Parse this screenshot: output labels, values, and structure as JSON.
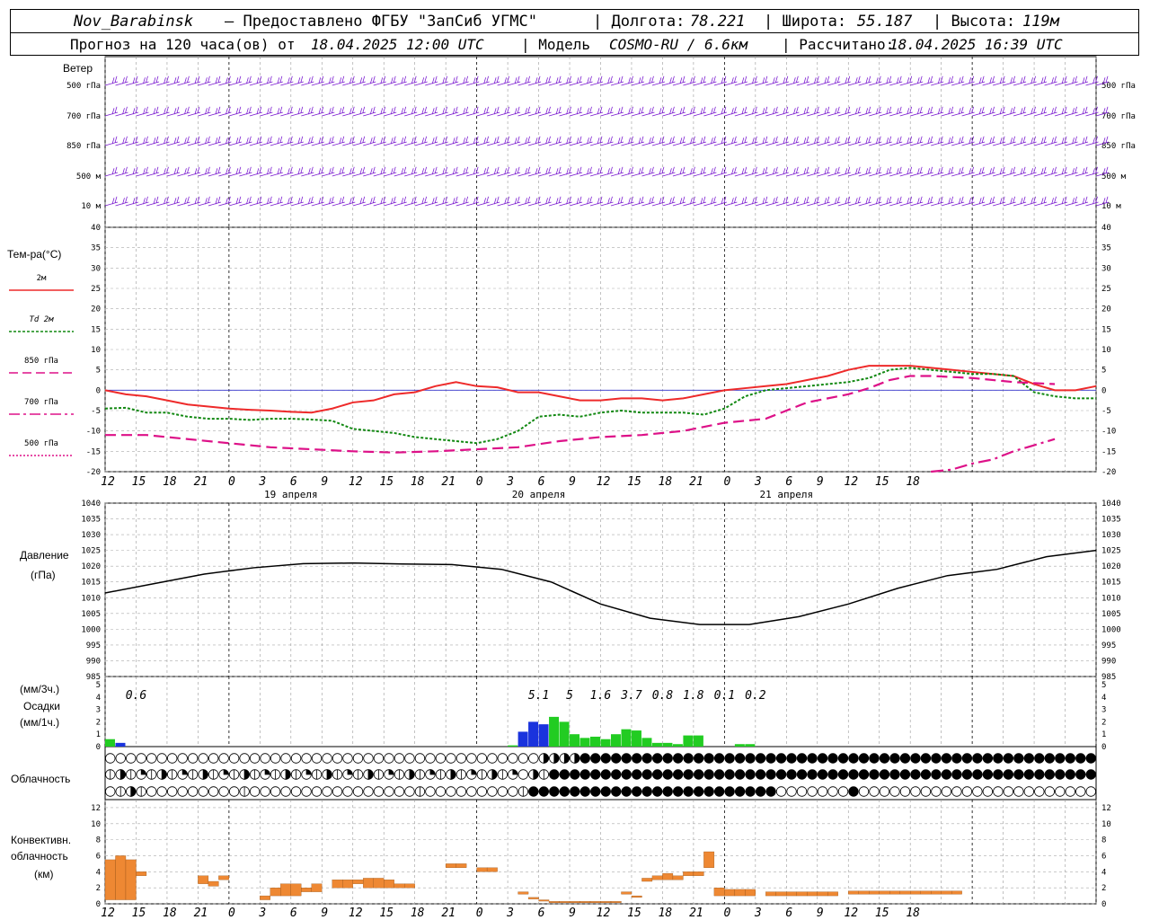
{
  "header": {
    "station": "Nov_Barabinsk",
    "provider": "– Предоставлено ФГБУ \"ЗапСиб УГМС\"",
    "lon_label": "| Долгота:",
    "lon_value": "78.221",
    "lat_label": "| Широта:",
    "lat_value": "55.187",
    "alt_label": "| Высота:",
    "alt_value": "119м",
    "forecast_label": "Прогноз на 120 часа(ов) от",
    "forecast_start": "18.04.2025 12:00 UTC",
    "model_label": "| Модель",
    "model_value": "COSMO-RU / 6.6км",
    "calc_label": "| Рассчитано:",
    "calc_value": "18.04.2025 16:39 UTC"
  },
  "x_axis": {
    "ticks": [
      "12",
      "15",
      "18",
      "21",
      "0",
      "3",
      "6",
      "9",
      "12",
      "15",
      "18",
      "21",
      "0",
      "3",
      "6",
      "9",
      "12",
      "15",
      "18",
      "21",
      "0",
      "3",
      "6",
      "9",
      "12",
      "15",
      "18"
    ],
    "dates": [
      "19 апреля",
      "20 апреля",
      "21 апреля"
    ]
  },
  "colors": {
    "t2m": "#ee2a2a",
    "td2m": "#118811",
    "t850": "#dd1188",
    "t700": "#dd1188",
    "t500": "#dd1188",
    "wind": "#7a1ad0",
    "pressure": "#000000",
    "precip_conv": "#1a33dd",
    "precip_large": "#22cc22",
    "conv_cloud": "#ee8833",
    "zero_line": "#3333cc"
  },
  "wind_panel": {
    "title": "Ветер",
    "levels": [
      "500 гПа",
      "700 гПа",
      "850 гПа",
      "500 м",
      "10 м"
    ]
  },
  "temp_panel": {
    "title": "Тем-ра(°С)",
    "legend": [
      {
        "label": "2м",
        "style": "solid"
      },
      {
        "label": "Td 2м",
        "style": "dotted"
      },
      {
        "label": "850 гПа",
        "style": "dash"
      },
      {
        "label": "700 гПа",
        "style": "dashdot"
      },
      {
        "label": "500 гПа",
        "style": "dotted"
      }
    ],
    "yticks": [
      "40",
      "35",
      "30",
      "25",
      "20",
      "15",
      "10",
      "5",
      "0",
      "-5",
      "-10",
      "-15",
      "-20"
    ]
  },
  "pressure_panel": {
    "title_1": "Давление",
    "title_2": "(гПа)",
    "yticks": [
      "1040",
      "1035",
      "1030",
      "1025",
      "1020",
      "1015",
      "1010",
      "1005",
      "1000",
      "995",
      "990",
      "985"
    ]
  },
  "precip_panel": {
    "title_1": "(мм/3ч.)",
    "title_2": "Осадки",
    "title_3": "(мм/1ч.)",
    "yticks": [
      "5",
      "4",
      "3",
      "2",
      "1",
      "0"
    ],
    "totals": [
      {
        "hour": 3,
        "text": "0.6"
      },
      {
        "hour": 42,
        "text": "5.1"
      },
      {
        "hour": 45,
        "text": "5"
      },
      {
        "hour": 48,
        "text": "1.6"
      },
      {
        "hour": 51,
        "text": "3.7"
      },
      {
        "hour": 54,
        "text": "0.8"
      },
      {
        "hour": 57,
        "text": "1.8"
      },
      {
        "hour": 60,
        "text": "0.1"
      },
      {
        "hour": 63,
        "text": "0.2"
      }
    ]
  },
  "cloud_panel": {
    "title": "Облачность"
  },
  "conv_panel": {
    "title_1": "Конвективн.",
    "title_2": "облачность",
    "title_3": "(км)",
    "yticks": [
      "12",
      "10",
      "8",
      "6",
      "4",
      "2",
      "0"
    ]
  },
  "chart_data": {
    "type": "line",
    "x_unit": "hours since 18.04.2025 12:00 UTC",
    "temperature": {
      "ylim": [
        -20,
        40
      ],
      "series": [
        {
          "name": "2м",
          "x": [
            0,
            2,
            4,
            6,
            8,
            10,
            12,
            14,
            16,
            18,
            20,
            22,
            24,
            26,
            28,
            30,
            32,
            34,
            36,
            38,
            40,
            42,
            44,
            46,
            48,
            50,
            52,
            54,
            56,
            58,
            60,
            62,
            64,
            66,
            68,
            70,
            72,
            74,
            76,
            78,
            80,
            82,
            84,
            86,
            88,
            90,
            92,
            94,
            96
          ],
          "y": [
            0,
            -1,
            -1.5,
            -2.5,
            -3.5,
            -4,
            -4.5,
            -4.8,
            -5,
            -5.3,
            -5.5,
            -4.5,
            -3,
            -2.5,
            -1,
            -0.5,
            1,
            2,
            1,
            0.7,
            -0.5,
            -0.5,
            -1.5,
            -2.5,
            -2.5,
            -2,
            -2,
            -2.5,
            -2,
            -1,
            0,
            0.5,
            1,
            1.5,
            2.5,
            3.5,
            5,
            6,
            6,
            6,
            5.5,
            5,
            4.5,
            4,
            3.5,
            1.5,
            0,
            0,
            1
          ]
        },
        {
          "name": "Td 2м",
          "x": [
            0,
            2,
            4,
            6,
            8,
            10,
            12,
            14,
            16,
            18,
            20,
            22,
            24,
            26,
            28,
            30,
            32,
            34,
            36,
            38,
            40,
            42,
            44,
            46,
            48,
            50,
            52,
            54,
            56,
            58,
            60,
            62,
            64,
            66,
            68,
            70,
            72,
            74,
            76,
            78,
            80,
            82,
            84,
            86,
            88,
            90,
            92,
            94,
            96
          ],
          "y": [
            -4.5,
            -4.3,
            -5.5,
            -5.5,
            -6.5,
            -7,
            -7,
            -7.3,
            -7,
            -7,
            -7.2,
            -7.5,
            -9.5,
            -10,
            -10.5,
            -11.5,
            -12,
            -12.5,
            -13,
            -12,
            -10,
            -6.5,
            -6,
            -6.5,
            -5.5,
            -5,
            -5.5,
            -5.5,
            -5.5,
            -6,
            -4.5,
            -1.5,
            0,
            0.5,
            1,
            1.5,
            2,
            3,
            5,
            5.5,
            5,
            4.5,
            4,
            4,
            3.5,
            -0.5,
            -1.5,
            -2,
            -2
          ]
        },
        {
          "name": "850 гПа",
          "x": [
            0,
            4,
            8,
            12,
            16,
            20,
            24,
            28,
            32,
            36,
            40,
            44,
            48,
            52,
            56,
            60,
            64,
            68,
            72,
            74,
            76,
            78,
            80,
            84,
            88,
            92
          ],
          "y": [
            -11,
            -11,
            -12,
            -13,
            -14,
            -14.5,
            -15,
            -15.3,
            -15,
            -14.5,
            -14,
            -12.5,
            -11.5,
            -11,
            -10,
            -8,
            -7,
            -3,
            -1,
            0.5,
            2.5,
            3.5,
            3.5,
            3,
            2,
            1.5
          ]
        },
        {
          "name": "700 гПа",
          "x": [
            80,
            82,
            84,
            86,
            88,
            90,
            92
          ],
          "y": [
            -20,
            -19.5,
            -18,
            -17,
            -15,
            -13.5,
            -12
          ]
        },
        {
          "name": "500 гПа",
          "x": [
            112,
            116,
            120,
            124,
            128
          ],
          "y": [
            -20,
            -20,
            -20,
            -20,
            -20
          ]
        }
      ]
    },
    "pressure": {
      "ylim": [
        985,
        1040
      ],
      "x": [
        0,
        6,
        12,
        18,
        24,
        30,
        36,
        42,
        48,
        54,
        60,
        66,
        72,
        78,
        84,
        90,
        96,
        102,
        108,
        114,
        120
      ],
      "y": [
        1011.5,
        1014.5,
        1017.5,
        1019.5,
        1020.8,
        1021,
        1020.7,
        1020.5,
        1019,
        1015,
        1008,
        1003.5,
        1001.5,
        1001.5,
        1004,
        1008,
        1013,
        1017,
        1019,
        1023,
        1025
      ]
    },
    "precip": {
      "ylim": [
        0,
        5
      ],
      "bars": [
        {
          "x": 0,
          "v": 0.6,
          "type": "large"
        },
        {
          "x": 1,
          "v": 0.3,
          "type": "conv"
        },
        {
          "x": 39,
          "v": 0.1,
          "type": "large"
        },
        {
          "x": 40,
          "v": 1.2,
          "type": "conv"
        },
        {
          "x": 41,
          "v": 2.0,
          "type": "conv"
        },
        {
          "x": 42,
          "v": 1.8,
          "type": "conv"
        },
        {
          "x": 43,
          "v": 2.4,
          "type": "large"
        },
        {
          "x": 44,
          "v": 2.0,
          "type": "large"
        },
        {
          "x": 45,
          "v": 1.0,
          "type": "large"
        },
        {
          "x": 46,
          "v": 0.7,
          "type": "large"
        },
        {
          "x": 47,
          "v": 0.8,
          "type": "large"
        },
        {
          "x": 48,
          "v": 0.6,
          "type": "large"
        },
        {
          "x": 49,
          "v": 1.0,
          "type": "large"
        },
        {
          "x": 50,
          "v": 1.4,
          "type": "large"
        },
        {
          "x": 51,
          "v": 1.3,
          "type": "large"
        },
        {
          "x": 52,
          "v": 0.7,
          "type": "large"
        },
        {
          "x": 53,
          "v": 0.3,
          "type": "large"
        },
        {
          "x": 54,
          "v": 0.3,
          "type": "large"
        },
        {
          "x": 55,
          "v": 0.2,
          "type": "large"
        },
        {
          "x": 56,
          "v": 0.9,
          "type": "large"
        },
        {
          "x": 57,
          "v": 0.9,
          "type": "large"
        },
        {
          "x": 61,
          "v": 0.2,
          "type": "large"
        },
        {
          "x": 62,
          "v": 0.2,
          "type": "large"
        }
      ]
    },
    "conv_cloud": {
      "ylim": [
        0,
        13
      ],
      "bars": [
        {
          "x": 0,
          "b": 0.5,
          "t": 5.5
        },
        {
          "x": 1,
          "b": 0.5,
          "t": 6
        },
        {
          "x": 2,
          "b": 0.5,
          "t": 5.5
        },
        {
          "x": 3,
          "b": 3.5,
          "t": 4
        },
        {
          "x": 9,
          "b": 2.5,
          "t": 3.5
        },
        {
          "x": 10,
          "b": 2.2,
          "t": 2.8
        },
        {
          "x": 11,
          "b": 3,
          "t": 3.5
        },
        {
          "x": 15,
          "b": 0.5,
          "t": 1
        },
        {
          "x": 16,
          "b": 1,
          "t": 2
        },
        {
          "x": 17,
          "b": 1,
          "t": 2.5
        },
        {
          "x": 18,
          "b": 1,
          "t": 2.5
        },
        {
          "x": 19,
          "b": 1.5,
          "t": 2
        },
        {
          "x": 20,
          "b": 1.5,
          "t": 2.5
        },
        {
          "x": 22,
          "b": 2,
          "t": 3
        },
        {
          "x": 23,
          "b": 2,
          "t": 3
        },
        {
          "x": 24,
          "b": 2.5,
          "t": 3
        },
        {
          "x": 25,
          "b": 2,
          "t": 3.2
        },
        {
          "x": 26,
          "b": 2,
          "t": 3.2
        },
        {
          "x": 27,
          "b": 2,
          "t": 3
        },
        {
          "x": 28,
          "b": 2,
          "t": 2.5
        },
        {
          "x": 29,
          "b": 2,
          "t": 2.5
        },
        {
          "x": 33,
          "b": 4.5,
          "t": 5
        },
        {
          "x": 34,
          "b": 4.5,
          "t": 5
        },
        {
          "x": 36,
          "b": 4,
          "t": 4.5
        },
        {
          "x": 37,
          "b": 4,
          "t": 4.5
        },
        {
          "x": 40,
          "b": 1.2,
          "t": 1.5
        },
        {
          "x": 41,
          "b": 0.6,
          "t": 0.8
        },
        {
          "x": 42,
          "b": 0.4,
          "t": 0.5
        },
        {
          "x": 43,
          "b": 0.2,
          "t": 0.3
        },
        {
          "x": 44,
          "b": 0.2,
          "t": 0.3
        },
        {
          "x": 45,
          "b": 0.2,
          "t": 0.3
        },
        {
          "x": 46,
          "b": 0.2,
          "t": 0.3
        },
        {
          "x": 47,
          "b": 0.2,
          "t": 0.3
        },
        {
          "x": 48,
          "b": 0.2,
          "t": 0.3
        },
        {
          "x": 49,
          "b": 0.2,
          "t": 0.3
        },
        {
          "x": 50,
          "b": 1.2,
          "t": 1.5
        },
        {
          "x": 51,
          "b": 0.8,
          "t": 1
        },
        {
          "x": 52,
          "b": 2.8,
          "t": 3.2
        },
        {
          "x": 53,
          "b": 3,
          "t": 3.5
        },
        {
          "x": 54,
          "b": 3,
          "t": 3.8
        },
        {
          "x": 55,
          "b": 3,
          "t": 3.5
        },
        {
          "x": 56,
          "b": 3.5,
          "t": 4
        },
        {
          "x": 57,
          "b": 3.5,
          "t": 4
        },
        {
          "x": 58,
          "b": 4.5,
          "t": 6.5
        },
        {
          "x": 59,
          "b": 1,
          "t": 2
        },
        {
          "x": 60,
          "b": 1,
          "t": 1.8
        },
        {
          "x": 61,
          "b": 1,
          "t": 1.8
        },
        {
          "x": 62,
          "b": 1,
          "t": 1.8
        },
        {
          "x": 64,
          "b": 1,
          "t": 1.5
        },
        {
          "x": 65,
          "b": 1,
          "t": 1.5
        },
        {
          "x": 66,
          "b": 1,
          "t": 1.5
        },
        {
          "x": 67,
          "b": 1,
          "t": 1.5
        },
        {
          "x": 68,
          "b": 1,
          "t": 1.5
        },
        {
          "x": 69,
          "b": 1,
          "t": 1.5
        },
        {
          "x": 70,
          "b": 1,
          "t": 1.5
        },
        {
          "x": 72,
          "b": 1.2,
          "t": 1.6
        },
        {
          "x": 73,
          "b": 1.2,
          "t": 1.6
        },
        {
          "x": 74,
          "b": 1.2,
          "t": 1.6
        },
        {
          "x": 75,
          "b": 1.2,
          "t": 1.6
        },
        {
          "x": 76,
          "b": 1.2,
          "t": 1.6
        },
        {
          "x": 77,
          "b": 1.2,
          "t": 1.6
        },
        {
          "x": 78,
          "b": 1.2,
          "t": 1.6
        },
        {
          "x": 79,
          "b": 1.2,
          "t": 1.6
        },
        {
          "x": 80,
          "b": 1.2,
          "t": 1.6
        },
        {
          "x": 81,
          "b": 1.2,
          "t": 1.6
        },
        {
          "x": 82,
          "b": 1.2,
          "t": 1.6
        }
      ]
    },
    "cloud_rows": [
      "000000000000000000000000000000000000000000333344444444444444444444444444444444444444444444444444444444444444444444440000000000000000000000000000000000000000000000000000000000000000000000000000",
      "131213121312131213121312131213121312131203144444444444444444444444444444444444444444444444444444444444444444444444440000000000000000000000000000000000000000000000000000000000000000000000000000",
      "013100000000010000000000000000100000000014444444444444444444444440000000400000000000000000000000000000000000000000000000000000000000000000000000000000000000000000000000000000000000000000000000"
    ]
  }
}
